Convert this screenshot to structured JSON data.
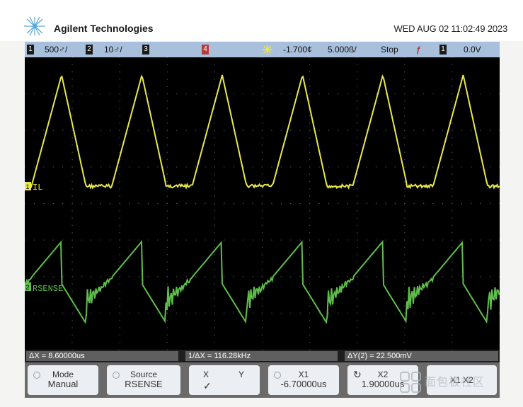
{
  "header": {
    "brand": "Agilent Technologies",
    "datetime": "WED AUG 02 11:02:49 2023",
    "logo_icon": "spark-logo-icon"
  },
  "statusbar": {
    "ch1_number": "1",
    "ch1_scale": "500♂/",
    "ch2_number": "2",
    "ch2_scale": "10♂/",
    "ch3_number": "3",
    "ch4_number": "4",
    "trigger_icon": "trigger-icon",
    "trigger_offset": "-1.700¢",
    "timebase": "5.000ß/",
    "run_state": "Stop",
    "slope_symbol": "ƒ",
    "trig_source": "1",
    "trig_level": "0.0V"
  },
  "screen": {
    "ch1_label": "IL",
    "ch2_label": "RSENSE",
    "ch1_color": "#e8e84a",
    "ch2_color": "#5fbf4a"
  },
  "measurements": {
    "dx": "ΔX = 8.60000us",
    "inv_dx": "1/ΔX = 116.28kHz",
    "dy": "ΔY(2) = 22.500mV"
  },
  "softkeys": {
    "mode_label": "Mode",
    "mode_value": "Manual",
    "source_label": "Source",
    "source_value": "RSENSE",
    "x_label": "X",
    "y_label": "Y",
    "x_check": "✓",
    "x1_label": "X1",
    "x1_value": "-6.70000us",
    "x2_label": "X2",
    "x2_value": "1.90000us",
    "x1x2_label": "X1 X2"
  },
  "watermark": {
    "text": "面包板社区"
  }
}
